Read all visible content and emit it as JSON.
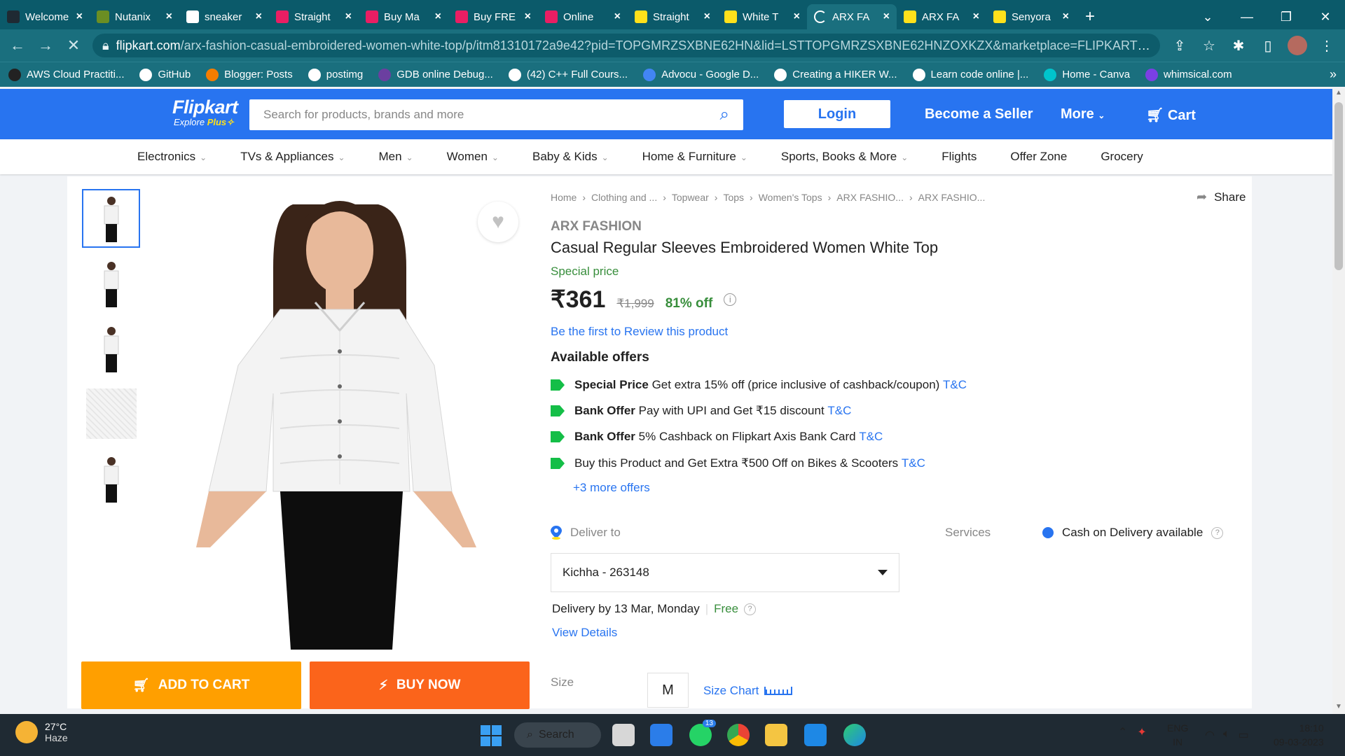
{
  "browser": {
    "tabs": [
      {
        "title": "Welcome",
        "color": "#1f2a33",
        "active": false
      },
      {
        "title": "Nutanix",
        "color": "#6b8e23",
        "active": false
      },
      {
        "title": "sneaker",
        "color": "#ffffff",
        "active": false
      },
      {
        "title": "Straight",
        "color": "#e91e63",
        "active": false
      },
      {
        "title": "Buy Ma",
        "color": "#e91e63",
        "active": false
      },
      {
        "title": "Buy FRE",
        "color": "#e91e63",
        "active": false
      },
      {
        "title": "Online",
        "color": "#e91e63",
        "active": false
      },
      {
        "title": "Straight",
        "color": "#ffe11b",
        "active": false
      },
      {
        "title": "White T",
        "color": "#ffe11b",
        "active": false
      },
      {
        "title": "ARX FA",
        "color": "#1a6f7e",
        "active": true
      },
      {
        "title": "ARX FA",
        "color": "#ffe11b",
        "active": false
      },
      {
        "title": "Senyora",
        "color": "#ffe11b",
        "active": false
      }
    ],
    "url_domain": "flipkart.com",
    "url_path": "/arx-fashion-casual-embroidered-women-white-top/p/itm81310172a9e42?pid=TOPGMRZSXBNE62HN&lid=LSTTOPGMRZSXBNE62HNZOXKZX&marketplace=FLIPKART&q=white...",
    "bookmarks": [
      {
        "label": "AWS Cloud Practiti...",
        "color": "#222"
      },
      {
        "label": "GitHub",
        "color": "#fff"
      },
      {
        "label": "Blogger: Posts",
        "color": "#f57d00"
      },
      {
        "label": "postimg",
        "color": "#fff"
      },
      {
        "label": "GDB online Debug...",
        "color": "#6b3fa0"
      },
      {
        "label": "(42) C++ Full Cours...",
        "color": "#fff"
      },
      {
        "label": "Advocu - Google D...",
        "color": "#4285f4"
      },
      {
        "label": "Creating a HIKER W...",
        "color": "#fff"
      },
      {
        "label": "Learn code online |...",
        "color": "#fff"
      },
      {
        "label": "Home - Canva",
        "color": "#00c4cc"
      },
      {
        "label": "whimsical.com",
        "color": "#7b3fe4"
      }
    ]
  },
  "header": {
    "logo": "Flipkart",
    "logo_sub": "Explore",
    "logo_plus": "Plus",
    "search_placeholder": "Search for products, brands and more",
    "login": "Login",
    "seller": "Become a Seller",
    "more": "More",
    "cart": "Cart"
  },
  "categories": [
    {
      "label": "Electronics",
      "dropdown": true
    },
    {
      "label": "TVs & Appliances",
      "dropdown": true
    },
    {
      "label": "Men",
      "dropdown": true
    },
    {
      "label": "Women",
      "dropdown": true
    },
    {
      "label": "Baby & Kids",
      "dropdown": true
    },
    {
      "label": "Home & Furniture",
      "dropdown": true
    },
    {
      "label": "Sports, Books & More",
      "dropdown": true
    },
    {
      "label": "Flights",
      "dropdown": false
    },
    {
      "label": "Offer Zone",
      "dropdown": false
    },
    {
      "label": "Grocery",
      "dropdown": false
    }
  ],
  "product": {
    "breadcrumbs": [
      "Home",
      "Clothing and ...",
      "Topwear",
      "Tops",
      "Women's Tops",
      "ARX FASHIO...",
      "ARX FASHIO..."
    ],
    "share": "Share",
    "brand": "ARX FASHION",
    "title": "Casual Regular Sleeves Embroidered Women White Top",
    "special": "Special price",
    "price": "₹361",
    "mrp": "₹1,999",
    "discount": "81% off",
    "review": "Be the first to Review this product",
    "offers_heading": "Available offers",
    "offers": [
      {
        "bold": "Special Price",
        "text": "Get extra 15% off (price inclusive of cashback/coupon)",
        "tc": "T&C"
      },
      {
        "bold": "Bank Offer",
        "text": "Pay with UPI and Get ₹15 discount",
        "tc": "T&C"
      },
      {
        "bold": "Bank Offer",
        "text": "5% Cashback on Flipkart Axis Bank Card",
        "tc": "T&C"
      },
      {
        "bold": "",
        "text": "Buy this Product and Get Extra ₹500 Off on Bikes & Scooters",
        "tc": "T&C"
      }
    ],
    "more_offers": "+3 more offers",
    "deliver_to": "Deliver to",
    "pincode": "Kichha - 263148",
    "delivery_by": "Delivery by 13 Mar, Monday",
    "delivery_fee": "Free",
    "view_details": "View Details",
    "services": "Services",
    "cod": "Cash on Delivery available",
    "size_label": "Size",
    "size_value": "M",
    "size_chart": "Size Chart",
    "add_to_cart": "ADD TO CART",
    "buy_now": "BUY NOW"
  },
  "taskbar": {
    "temp": "27°C",
    "weather": "Haze",
    "search": "Search",
    "whatsapp_badge": "13",
    "lang1": "ENG",
    "lang2": "IN",
    "time": "18:10",
    "date": "09-03-2023"
  }
}
